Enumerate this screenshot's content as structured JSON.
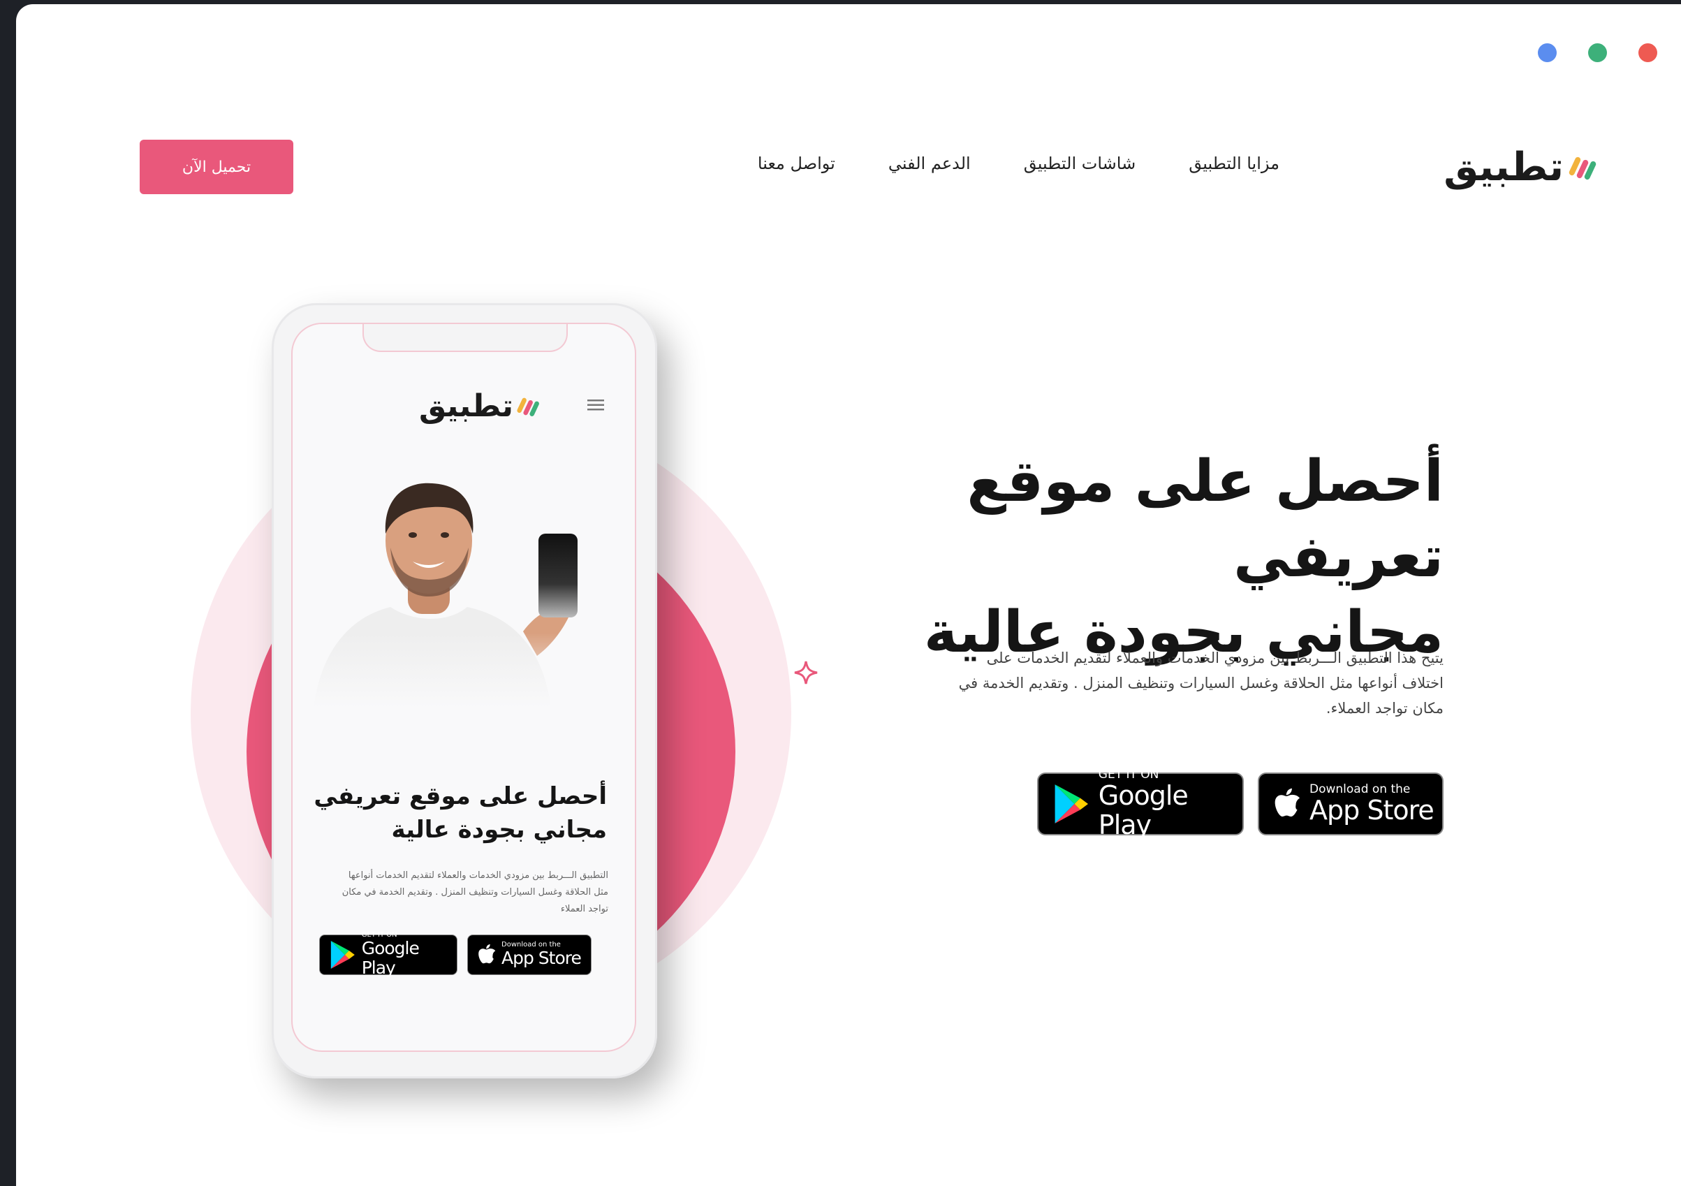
{
  "window": {
    "controls": [
      {
        "name": "blue",
        "color": "#5b8def"
      },
      {
        "name": "green",
        "color": "#3db07a"
      },
      {
        "name": "red",
        "color": "#ee5a52"
      }
    ]
  },
  "header": {
    "logo_text": "تطبيق",
    "nav": [
      "مزايا التطبيق",
      "شاشات التطبيق",
      "الدعم الفني",
      "تواصل معنا"
    ],
    "cta_label": "تحميل الآن"
  },
  "hero": {
    "title_line1": "أحصل على موقع تعريفي",
    "title_line2": "مجاني بجودة عالية",
    "description": "يتيح هذا التطبيق الـــربط بين مزودي الخدمات والعملاء لتقديم الخدمات على اختلاف أنواعها مثل الحلاقة وغسل السيارات وتنظيف المنزل . وتقديم الخدمة في مكان تواجد العملاء."
  },
  "stores": {
    "google_small": "GET IT ON",
    "google_big": "Google Play",
    "apple_small": "Download on the",
    "apple_big": "App Store"
  },
  "phone": {
    "logo_text": "تطبيق",
    "title_line1": "أحصل على موقع تعريفي",
    "title_line2": "مجاني بجودة عالية",
    "description": "التطبيق الـــربط بين مزودي الخدمات والعملاء لتقديم الخدمات أنواعها مثل الحلاقة وغسل السيارات وتنظيف المنزل . وتقديم الخدمة في مكان تواجد العملاء"
  },
  "colors": {
    "accent": "#e9587b",
    "accent_light": "#fbe9ee",
    "dark": "#1e2127"
  },
  "icons": [
    "logo-mark-icon",
    "hamburger-menu-icon",
    "google-play-icon",
    "apple-icon",
    "sparkle-icon"
  ]
}
